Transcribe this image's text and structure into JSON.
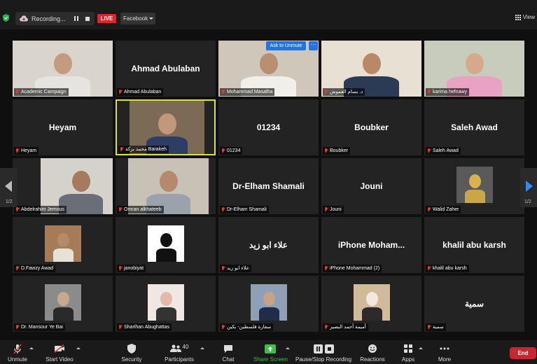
{
  "topbar": {
    "recording_label": "Recording...",
    "live_label": "LIVE",
    "stream_target": "Facebook",
    "view_label": "View"
  },
  "ask_to_unmute": "Ask to Unmute",
  "more_label": "···",
  "pages": {
    "left": "1/2",
    "right": "1/2"
  },
  "participants": [
    {
      "name": "Academic Campaign",
      "display": "",
      "video": true
    },
    {
      "name": "Ahmad Abulaban",
      "display": "Ahmad Abulaban",
      "video": false
    },
    {
      "name": "Mohammad Masalha",
      "display": "",
      "video": true
    },
    {
      "name": "د. بسام العموش",
      "display": "",
      "video": true
    },
    {
      "name": "karima hefnawy",
      "display": "",
      "video": true
    },
    {
      "name": "Heyam",
      "display": "Heyam",
      "video": false
    },
    {
      "name": "محمد بركة Barakeh",
      "display": "",
      "video": true
    },
    {
      "name": "01234",
      "display": "01234",
      "video": false
    },
    {
      "name": "Boubker",
      "display": "Boubker",
      "video": false
    },
    {
      "name": "Saleh Awad",
      "display": "Saleh Awad",
      "video": false
    },
    {
      "name": "Abdelrahim Jemous",
      "display": "",
      "video": true
    },
    {
      "name": "Omran alkhateeb",
      "display": "",
      "video": true
    },
    {
      "name": "Dr-Elham Shamali",
      "display": "Dr-Elham Shamali",
      "video": false
    },
    {
      "name": "Jouni",
      "display": "Jouni",
      "video": false
    },
    {
      "name": "Walid Zaher",
      "display": "",
      "video": true
    },
    {
      "name": "D.Fawzy Awad",
      "display": "",
      "video": true
    },
    {
      "name": "janobiyat",
      "display": "",
      "video": true
    },
    {
      "name": "علاء ابو زيد",
      "display": "علاء ابو زيد",
      "video": false
    },
    {
      "name": "iPhone Mohammad (2)",
      "display": "iPhone Moham...",
      "video": false
    },
    {
      "name": "khalil abu karsh",
      "display": "khalil abu karsh",
      "video": false
    },
    {
      "name": "Dr. Mansour Ye Bai",
      "display": "",
      "video": true
    },
    {
      "name": "Sharihan Abughattas",
      "display": "",
      "video": true
    },
    {
      "name": "سفارة فلسطين- بكين",
      "display": "",
      "video": true
    },
    {
      "name": "أميمة أحمد البصير",
      "display": "",
      "video": true
    },
    {
      "name": "سمية",
      "display": "سمية",
      "video": false
    }
  ],
  "toolbar": {
    "unmute": "Unmute",
    "start_video": "Start Video",
    "security": "Security",
    "participants": "Participants",
    "participants_count": "40",
    "chat": "Chat",
    "share_screen": "Share Screen",
    "pause_stop_recording": "Pause/Stop Recording",
    "reactions": "Reactions",
    "apps": "Apps",
    "more": "More",
    "end": "End"
  },
  "colors": {
    "active_speaker": "#d7e04a",
    "live": "#e0242a",
    "share_green": "#3fbf4a",
    "end_red": "#c9272d",
    "accent_blue": "#1e74e8"
  }
}
